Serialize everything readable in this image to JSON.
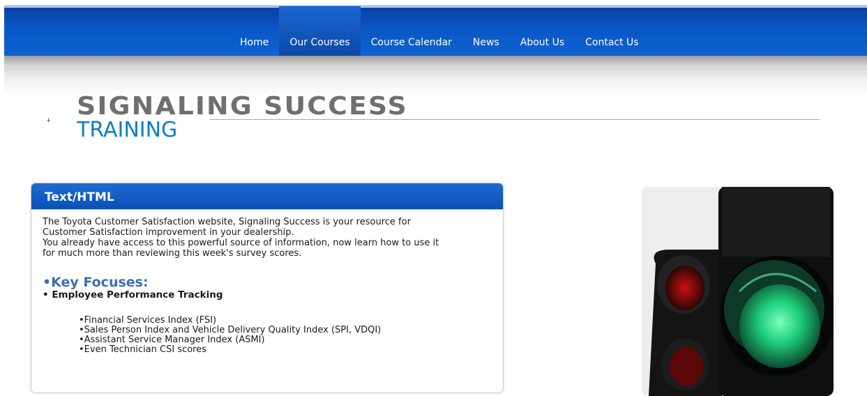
{
  "nav": {
    "items": [
      {
        "label": "Home",
        "active": false
      },
      {
        "label": "Our Courses",
        "active": true
      },
      {
        "label": "Course Calendar",
        "active": false
      },
      {
        "label": "News",
        "active": false
      },
      {
        "label": "About Us",
        "active": false
      },
      {
        "label": "Contact Us",
        "active": false
      }
    ]
  },
  "logo": {
    "title": "SIGNALING SUCCESS",
    "subtitle": "TRAINING"
  },
  "panel": {
    "title": "Text/HTML",
    "paragraph1": "The Toyota Customer Satisfaction website, Signaling Success is your resource for",
    "paragraph1b": "Customer Satisfaction improvement in your dealership.",
    "paragraph2": "You already have access to this powerful source of information, now learn how to use it",
    "paragraph2b": "for much more than reviewing this week's survey scores.",
    "focus_heading": "•Key Focuses:",
    "focus_item": "• Employee Performance Tracking",
    "sub_items": [
      "Financial Services Index (FSI)",
      "Sales Person Index and Vehicle Delivery Quality Index (SPI, VDQI)",
      "Assistant Service Manager Index (ASMI)",
      "Even Technician CSI scores"
    ]
  },
  "colors": {
    "nav_blue": "#0a57c6",
    "logo_gray": "#6f6f6f",
    "logo_blue": "#0c7fc2",
    "focus_blue": "#3a6fb5",
    "signal_green": "#39d98a"
  },
  "image": {
    "icon": "traffic-light-image"
  }
}
